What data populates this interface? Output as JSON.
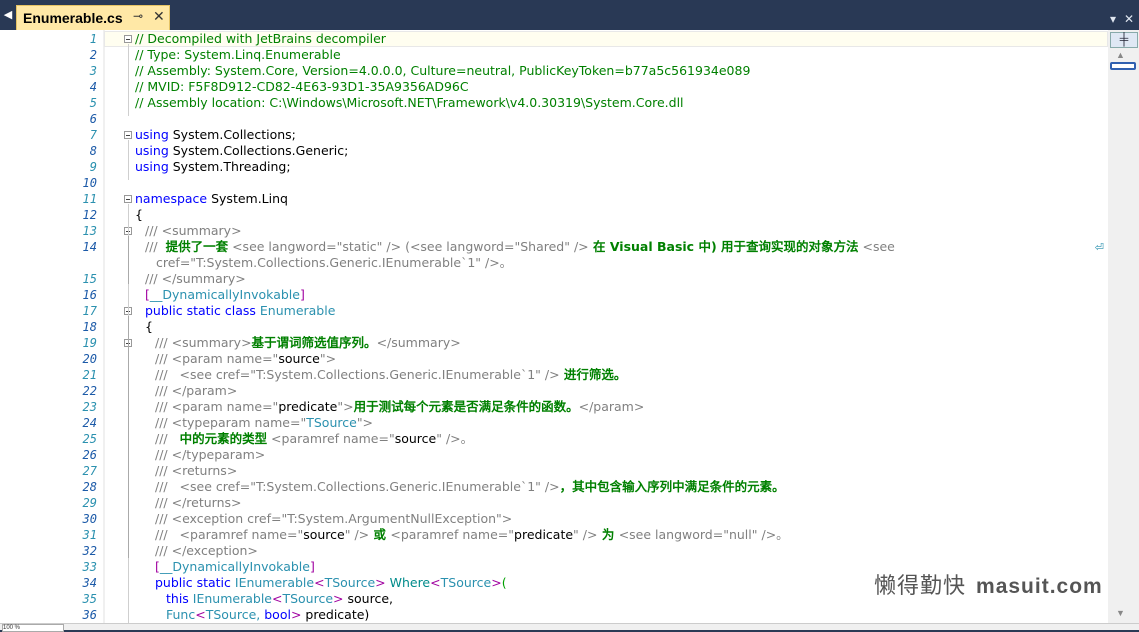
{
  "tab": {
    "title": "Enumerable.cs",
    "pin_glyph": "⊸",
    "close_glyph": "✕"
  },
  "window_controls": {
    "dropdown_glyph": "▾",
    "close_glyph": "✕"
  },
  "scrollbar": {
    "split_glyph": "╪",
    "up_glyph": "▲",
    "down_glyph": "▼"
  },
  "status": {
    "zoom_label": "100 %"
  },
  "watermark": {
    "cn": "懒得勤快",
    "en": "masuit.com"
  },
  "line_numbers": [
    "1",
    "2",
    "3",
    "4",
    "5",
    "6",
    "7",
    "8",
    "9",
    "10",
    "11",
    "12",
    "13",
    "14",
    "15",
    "16",
    "17",
    "18",
    "19",
    "20",
    "21",
    "22",
    "23",
    "24",
    "25",
    "26",
    "27",
    "28",
    "29",
    "30",
    "31",
    "32",
    "33",
    "34",
    "35",
    "36"
  ],
  "code": {
    "l1": "// Decompiled with JetBrains decompiler",
    "l2": "// Type: System.Linq.Enumerable",
    "l3": "// Assembly: System.Core, Version=4.0.0.0, Culture=neutral, PublicKeyToken=b77a5c561934e089",
    "l4": "// MVID: F5F8D912-CD82-4E63-93D1-35A9356AD96C",
    "l5": "// Assembly location: C:\\Windows\\Microsoft.NET\\Framework\\v4.0.30319\\System.Core.dll",
    "l7_kw": "using",
    "l7_rest": " System.Collections;",
    "l8_kw": "using",
    "l8_rest": " System.Collections.Generic;",
    "l9_kw": "using",
    "l9_rest": " System.Threading;",
    "l11_kw": "namespace",
    "l11_rest": " System.Linq",
    "l12": "{",
    "l13": "/// <summary>",
    "l14_a": "///  ",
    "l14_b": "提供了一套",
    "l14_c": " <see langword=\"static\" /> (<see langword=\"Shared\" />",
    "l14_d": " 在 Visual Basic 中) 用于查询实现的对象方法",
    "l14_e": " <see",
    "l14_wrap": "⏎",
    "l14b": "cref=\"T:System.Collections.Generic.IEnumerable`1\" />。",
    "l15": "/// </summary>",
    "l16_a": "[",
    "l16_b": "__DynamicallyInvokable",
    "l16_c": "]",
    "l17_a": "public static class",
    "l17_b": " Enumerable",
    "l18": "{",
    "l19_a": "/// <summary>",
    "l19_b": "基于谓词筛选值序列。",
    "l19_c": "</summary>",
    "l20_a": "/// <param name=\"",
    "l20_b": "source",
    "l20_c": "\">",
    "l21_a": "///   <see cref=\"T:System.Collections.Generic.IEnumerable`1\" />",
    "l21_b": " 进行筛选。",
    "l22": "/// </param>",
    "l23_a": "/// <param name=\"",
    "l23_b": "predicate",
    "l23_c": "\">",
    "l23_d": "用于测试每个元素是否满足条件的函数。",
    "l23_e": "</param>",
    "l24_a": "/// <typeparam name=\"",
    "l24_b": "TSource",
    "l24_c": "\">",
    "l25_a": "///   ",
    "l25_b": "中的元素的类型",
    "l25_c": " <paramref name=\"",
    "l25_d": "source",
    "l25_e": "\" />。",
    "l26": "/// </typeparam>",
    "l27": "/// <returns>",
    "l28_a": "///   <see cref=\"T:System.Collections.Generic.IEnumerable`1\" />",
    "l28_b": "，其中包含输入序列中满足条件的元素。",
    "l29": "/// </returns>",
    "l30": "/// <exception cref=\"T:System.ArgumentNullException\">",
    "l31_a": "///   <paramref name=\"",
    "l31_b": "source",
    "l31_c": "\" />",
    "l31_d": " 或 ",
    "l31_e": "<paramref name=\"",
    "l31_f": "predicate",
    "l31_g": "\" />",
    "l31_h": " 为 ",
    "l31_i": "<see langword=\"null\" />。",
    "l32": "/// </exception>",
    "l33_a": "[",
    "l33_b": "__DynamicallyInvokable",
    "l33_c": "]",
    "l34_a": "public static",
    "l34_b": " IEnumerable",
    "l34_c": "<",
    "l34_d": "TSource",
    "l34_e": ">",
    "l34_f": " Where",
    "l34_g": "<",
    "l34_h": "TSource",
    "l34_i": ">",
    "l34_j": "(",
    "l35_a": "this",
    "l35_b": " IEnumerable",
    "l35_c": "<",
    "l35_d": "TSource",
    "l35_e": ">",
    "l35_f": " source,",
    "l36_a": "Func",
    "l36_b": "<",
    "l36_c": "TSource, ",
    "l36_d": "bool",
    "l36_e": ">",
    "l36_f": " predicate)"
  }
}
